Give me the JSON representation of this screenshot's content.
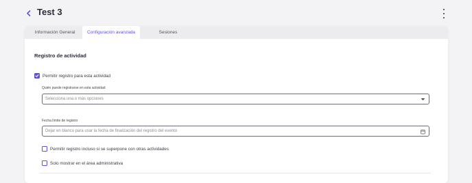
{
  "header": {
    "title": "Test 3"
  },
  "tabs": [
    {
      "label": "Información General"
    },
    {
      "label": "Configuración avanzada"
    },
    {
      "label": "Sesiones"
    }
  ],
  "activity_log": {
    "section_title": "Registro de actividad",
    "allow_registration": {
      "label": "Permitir registro para esta actividad",
      "checked": true
    },
    "who_can_register": {
      "label": "Quién puede registrarse en esta actividad",
      "placeholder": "Selecciona una o más opciones"
    },
    "deadline": {
      "label": "Fecha límite de registro",
      "placeholder": "Dejar en blanco para usar la fecha de finalización del registro del evento"
    },
    "allow_overlap": {
      "label": "Permitir registro incluso si se superpone con otras actividades",
      "checked": false
    },
    "admin_only": {
      "label": "Solo mostrar en el área administrativa",
      "checked": false
    }
  },
  "colors": {
    "accent": "#5b54d6",
    "background": "#f3f3f5",
    "card": "#ffffff"
  }
}
